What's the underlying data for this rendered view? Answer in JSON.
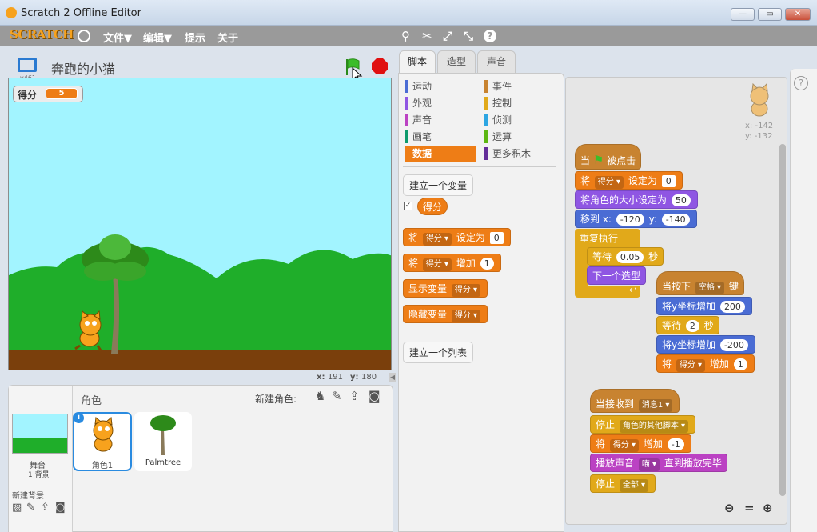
{
  "window": {
    "title": "Scratch 2 Offline Editor",
    "minimize": "—",
    "maximize": "▭",
    "close": "✕"
  },
  "menu": {
    "logo": "SCRATCH",
    "file": "文件▼",
    "edit": "编辑▼",
    "tips": "提示",
    "about": "关于"
  },
  "project": {
    "title": "奔跑的小猫",
    "version": "v461"
  },
  "stage": {
    "var_label": "得分",
    "var_value": "5",
    "x_label": "x:",
    "x_value": "191",
    "y_label": "y:",
    "y_value": "180"
  },
  "sprites": {
    "header": "角色",
    "new_sprite": "新建角色:",
    "stage_label": "舞台",
    "stage_sub": "1 背景",
    "new_backdrop": "新建背景",
    "items": [
      {
        "name": "角色1"
      },
      {
        "name": "Palmtree"
      }
    ]
  },
  "tabs": {
    "scripts": "脚本",
    "costumes": "造型",
    "sounds": "声音"
  },
  "categories": {
    "left": [
      "运动",
      "外观",
      "声音",
      "画笔",
      "数据"
    ],
    "right": [
      "事件",
      "控制",
      "侦测",
      "运算",
      "更多积木"
    ]
  },
  "palette": {
    "make_var": "建立一个变量",
    "var_name": "得分",
    "set": "将",
    "set_to": "设定为",
    "set_val": "0",
    "change": "将",
    "change_by": "增加",
    "change_val": "1",
    "show": "显示变量",
    "hide": "隐藏变量",
    "make_list": "建立一个列表"
  },
  "sprite_info": {
    "x": "x: -142",
    "y": "y: -132"
  },
  "script1": {
    "hat_when": "当",
    "hat_clicked": "被点击",
    "set_pre": "将",
    "set_var": "得分",
    "set_to": "设定为",
    "set_val": "0",
    "size": "将角色的大小设定为",
    "size_val": "50",
    "goto": "移到 x:",
    "goto_x": "-120",
    "goto_y_label": "y:",
    "goto_y": "-140",
    "forever": "重复执行",
    "wait": "等待",
    "wait_val": "0.05",
    "wait_unit": "秒",
    "next_costume": "下一个造型"
  },
  "script2": {
    "when_key": "当按下",
    "key": "空格",
    "key_suffix": "键",
    "change_y": "将y坐标增加",
    "cy1": "200",
    "wait": "等待",
    "wait_val": "2",
    "wait_unit": "秒",
    "cy2": "-200",
    "chg_pre": "将",
    "chg_var": "得分",
    "chg_by": "增加",
    "chg_val": "1"
  },
  "script3": {
    "when_recv": "当接收到",
    "msg": "消息1",
    "stop": "停止",
    "stop_opt": "角色的其他脚本",
    "chg_pre": "将",
    "chg_var": "得分",
    "chg_by": "增加",
    "chg_val": "-1",
    "play": "播放声音",
    "sound": "喵",
    "play_until": "直到播放完毕",
    "stop2": "停止",
    "stop2_opt": "全部"
  },
  "colors": {
    "motion": "#4a6cd4",
    "looks": "#8f56e3",
    "sound": "#bb42c3",
    "pen": "#0e9a6c",
    "data": "#ee7d16",
    "events": "#c88330",
    "control": "#e1a91a",
    "sensing": "#2ca5e2",
    "operators": "#5cb712",
    "more": "#632d99"
  }
}
